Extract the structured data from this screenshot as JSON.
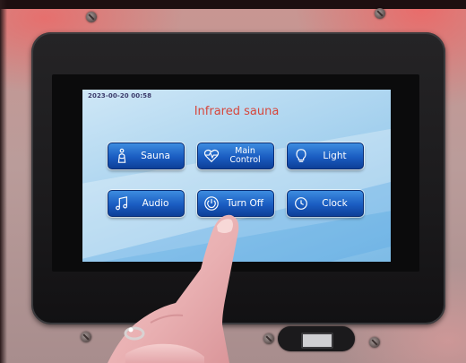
{
  "screen": {
    "datetime": "2023-00-20  00:58",
    "title": "Infrared sauna"
  },
  "buttons": {
    "sauna": {
      "label": "Sauna",
      "icon": "sauna-person-icon"
    },
    "main_control": {
      "label": "Main\nControl",
      "icon": "heartbeat-icon"
    },
    "light": {
      "label": "Light",
      "icon": "bulb-icon"
    },
    "audio": {
      "label": "Audio",
      "icon": "music-note-icon"
    },
    "turn_off": {
      "label": "Turn Off",
      "icon": "power-icon"
    },
    "clock": {
      "label": "Clock",
      "icon": "clock-icon"
    }
  },
  "colors": {
    "title": "#d6473c",
    "button": "#1a5cc1",
    "screen": "#a9d3ef"
  }
}
